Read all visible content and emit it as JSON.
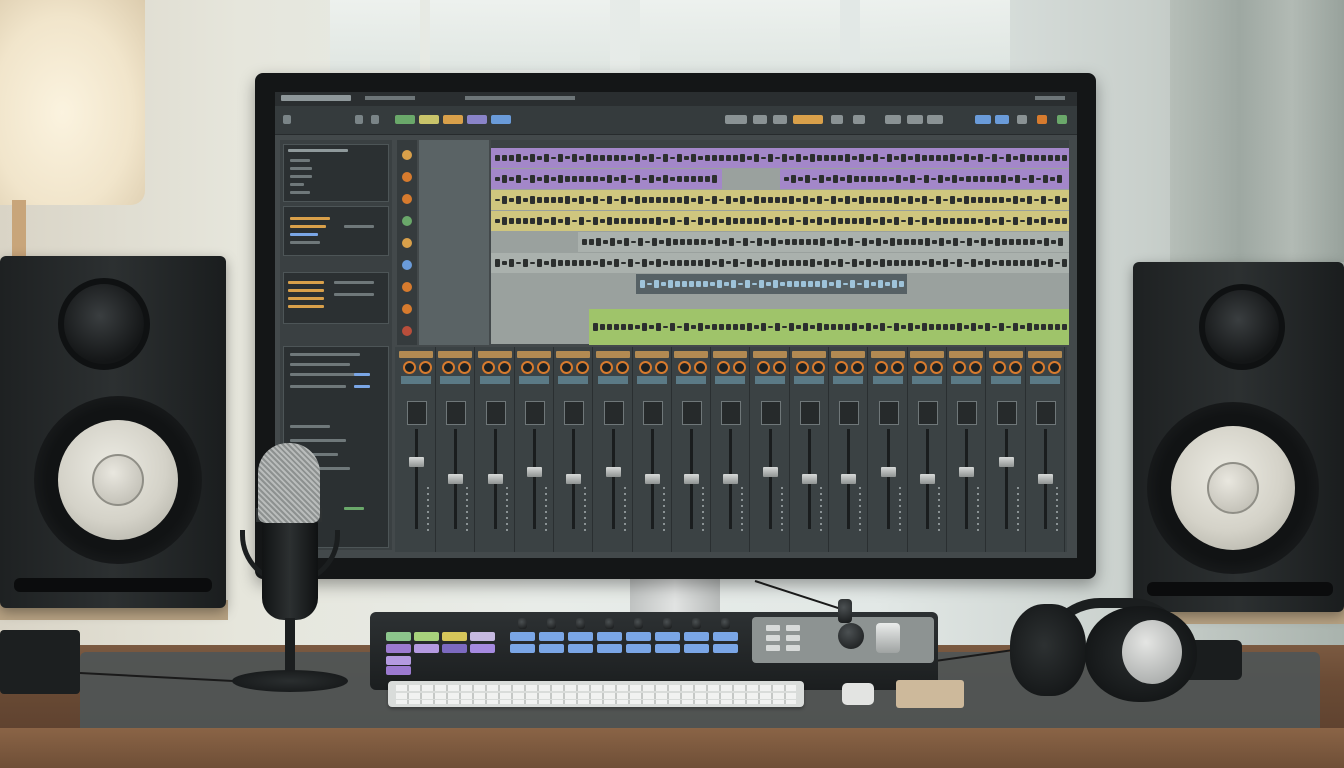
{
  "scene": {
    "description_label": "",
    "palette": {
      "wall": "#e6e9e5",
      "desk": "#6a4b35",
      "screen_bg": "#43494b",
      "waveform_purple": "#a387c9",
      "waveform_yellow": "#cfc67e",
      "waveform_grey": "#aab1ad",
      "waveform_green": "#9fc46a",
      "fader_accent": "#d77b2e"
    }
  },
  "daw": {
    "title_text": "",
    "lanes": [
      {
        "color": "#a387c9"
      },
      {
        "color": "#a387c9"
      },
      {
        "color": "#cfc67e"
      },
      {
        "color": "#cfc67e"
      },
      {
        "color": "#aab1ad"
      },
      {
        "color": "#aab1ad"
      },
      {
        "color": "#aab1ad"
      },
      {
        "color": "#9fc46a"
      }
    ],
    "toolbar_buttons": [
      {
        "color": "#6aa86a"
      },
      {
        "color": "#c9c46a"
      },
      {
        "color": "#d9a04a"
      },
      {
        "color": "#8a84c9"
      },
      {
        "color": "#6a9bd9"
      }
    ],
    "mixer_channel_count": 17,
    "fader_levels": [
      0.72,
      0.55,
      0.55,
      0.62,
      0.55,
      0.62,
      0.55,
      0.55,
      0.55,
      0.62,
      0.55,
      0.55,
      0.62,
      0.55,
      0.62,
      0.72,
      0.55
    ]
  },
  "controller": {
    "pad_colors_left": [
      "#8cc58c",
      "#a7d27c",
      "#d6c65a",
      "#c6b9e0",
      "#9c7ad0",
      "#b49ae0",
      "#7c6ac0",
      "#a58ae0"
    ],
    "pad_color_right": "#7aa6e6"
  }
}
